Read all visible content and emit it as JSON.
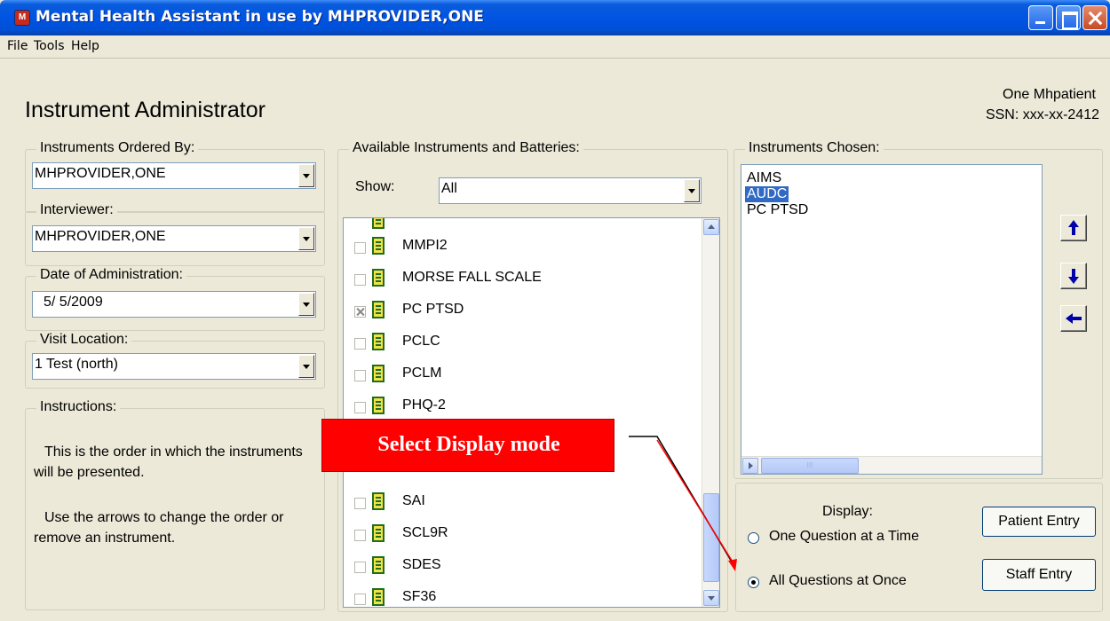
{
  "window": {
    "title": "Mental Health Assistant in use by MHPROVIDER,ONE"
  },
  "menu": [
    {
      "label": "File"
    },
    {
      "label": "Tools"
    },
    {
      "label": "Help"
    }
  ],
  "page_title": "Instrument Administrator",
  "patient": {
    "name": "One Mhpatient",
    "ssn": "SSN: xxx-xx-2412"
  },
  "ordered_by": {
    "label": "Instruments Ordered By:",
    "value": "MHPROVIDER,ONE"
  },
  "interviewer": {
    "label": "Interviewer:",
    "value": "MHPROVIDER,ONE"
  },
  "date_of_admin": {
    "label": "Date of Administration:",
    "value": "5/ 5/2009"
  },
  "visit_location": {
    "label": "Visit Location:",
    "value": "1 Test (north)"
  },
  "instructions": {
    "label": "Instructions:",
    "line1": "This is the order in which the instruments will be presented.",
    "line2": "Use the arrows to change the order or remove an instrument."
  },
  "available": {
    "label": "Available Instruments and Batteries:",
    "show_label": "Show:",
    "show_value": "All",
    "items": [
      {
        "label": "MMPI2",
        "checked": false
      },
      {
        "label": "MORSE FALL SCALE",
        "checked": false
      },
      {
        "label": "PC PTSD",
        "checked": true
      },
      {
        "label": "PCLC",
        "checked": false
      },
      {
        "label": "PCLM",
        "checked": false
      },
      {
        "label": "PHQ-2",
        "checked": false
      },
      {
        "label": "SAI",
        "checked": false
      },
      {
        "label": "SCL9R",
        "checked": false
      },
      {
        "label": "SDES",
        "checked": false
      },
      {
        "label": "SF36",
        "checked": false
      }
    ]
  },
  "chosen": {
    "label": "Instruments Chosen:",
    "items": [
      {
        "label": "AIMS",
        "selected": false
      },
      {
        "label": "AUDC",
        "selected": true
      },
      {
        "label": "PC PTSD",
        "selected": false
      }
    ],
    "scroll_thumb_text": "III"
  },
  "display": {
    "label": "Display:",
    "option_one": "One Question at a Time",
    "option_all": "All Questions at Once",
    "selected": "all"
  },
  "buttons": {
    "patient_entry": "Patient Entry",
    "staff_entry": "Staff Entry"
  },
  "annotation": {
    "text": "Select Display mode",
    "color": "#ff0000"
  },
  "colors": {
    "titlebar": "#0054e3",
    "selection": "#316ac5",
    "arrow_icon": "#0000aa"
  }
}
